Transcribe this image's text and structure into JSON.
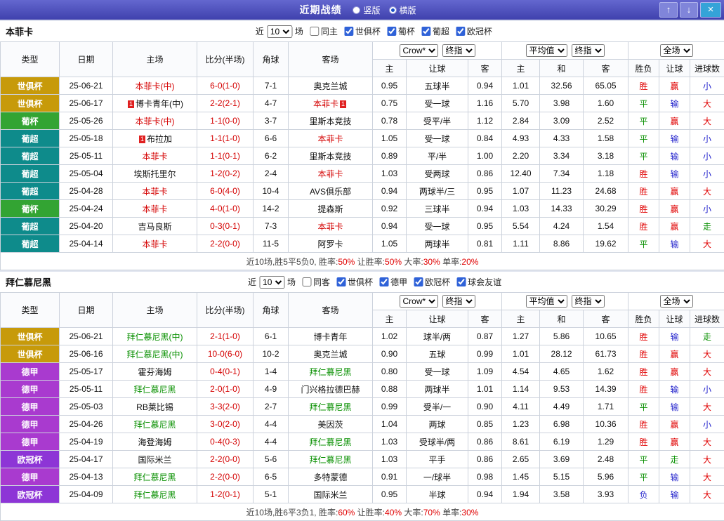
{
  "titlebar": {
    "title": "近期战绩",
    "radios": [
      {
        "label": "竖版",
        "selected": false
      },
      {
        "label": "横版",
        "selected": true
      }
    ],
    "buttons": {
      "up": "↑",
      "down": "↓",
      "close": "×"
    }
  },
  "filter_labels": {
    "near": "近",
    "count": "10",
    "games": "场"
  },
  "selects": {
    "odds_source": "Crow*",
    "odds_final": "终指",
    "avg_source": "平均值",
    "avg_final": "终指",
    "scope": "全场"
  },
  "table_headers": {
    "type": "类型",
    "date": "日期",
    "home": "主场",
    "score": "比分(半场)",
    "corner": "角球",
    "away": "客场",
    "odds_home": "主",
    "odds_handicap": "让球",
    "odds_away": "客",
    "avg_home": "主",
    "avg_draw": "和",
    "avg_away": "客",
    "result_wdl": "胜负",
    "result_handicap": "让球",
    "result_goals": "进球数"
  },
  "colors": {
    "competitions": {
      "世俱杯": "#C79A0A",
      "葡杯": "#33A433",
      "葡超": "#0E8B8B",
      "德甲": "#A93ACF",
      "欧冠杯": "#8D35D6"
    },
    "results": {
      "red": "#E00000",
      "blue": "#2323CC",
      "green": "#089000"
    },
    "score": "#D40000"
  },
  "sections": [
    {
      "team": "本菲卡",
      "team_color": "#D40000",
      "same_option": {
        "label": "同主",
        "checked": false
      },
      "competitions": [
        {
          "label": "世俱杯",
          "checked": true
        },
        {
          "label": "葡杯",
          "checked": true
        },
        {
          "label": "葡超",
          "checked": true
        },
        {
          "label": "欧冠杯",
          "checked": true
        }
      ],
      "rows": [
        {
          "comp": "世俱杯",
          "date": "25-06-21",
          "home": "本菲卡(中)",
          "home_is_team": true,
          "score": "6-0(1-0)",
          "corners": "7-1",
          "away": "奥克兰城",
          "away_is_team": false,
          "odds": [
            "0.95",
            "五球半",
            "0.94"
          ],
          "averages": [
            "1.01",
            "32.56",
            "65.05"
          ],
          "results": [
            {
              "text": "胜",
              "color": "red"
            },
            {
              "text": "赢",
              "color": "red"
            },
            {
              "text": "小",
              "color": "blue"
            }
          ]
        },
        {
          "comp": "世俱杯",
          "date": "25-06-17",
          "home": "博卡青年(中)",
          "home_is_team": false,
          "home_card": "1",
          "score": "2-2(2-1)",
          "corners": "4-7",
          "away": "本菲卡",
          "away_is_team": true,
          "away_card": "1",
          "odds": [
            "0.75",
            "受一球",
            "1.16"
          ],
          "averages": [
            "5.70",
            "3.98",
            "1.60"
          ],
          "results": [
            {
              "text": "平",
              "color": "green"
            },
            {
              "text": "输",
              "color": "blue"
            },
            {
              "text": "大",
              "color": "red"
            }
          ]
        },
        {
          "comp": "葡杯",
          "date": "25-05-26",
          "home": "本菲卡(中)",
          "home_is_team": true,
          "score": "1-1(0-0)",
          "corners": "3-7",
          "away": "里斯本竞技",
          "away_is_team": false,
          "odds": [
            "0.78",
            "受平/半",
            "1.12"
          ],
          "averages": [
            "2.84",
            "3.09",
            "2.52"
          ],
          "results": [
            {
              "text": "平",
              "color": "green"
            },
            {
              "text": "赢",
              "color": "red"
            },
            {
              "text": "大",
              "color": "red"
            }
          ]
        },
        {
          "comp": "葡超",
          "date": "25-05-18",
          "home": "布拉加",
          "home_is_team": false,
          "home_card": "1",
          "score": "1-1(1-0)",
          "corners": "6-6",
          "away": "本菲卡",
          "away_is_team": true,
          "odds": [
            "1.05",
            "受一球",
            "0.84"
          ],
          "averages": [
            "4.93",
            "4.33",
            "1.58"
          ],
          "results": [
            {
              "text": "平",
              "color": "green"
            },
            {
              "text": "输",
              "color": "blue"
            },
            {
              "text": "小",
              "color": "blue"
            }
          ]
        },
        {
          "comp": "葡超",
          "date": "25-05-11",
          "home": "本菲卡",
          "home_is_team": true,
          "score": "1-1(0-1)",
          "corners": "6-2",
          "away": "里斯本竞技",
          "away_is_team": false,
          "odds": [
            "0.89",
            "平/半",
            "1.00"
          ],
          "averages": [
            "2.20",
            "3.34",
            "3.18"
          ],
          "results": [
            {
              "text": "平",
              "color": "green"
            },
            {
              "text": "输",
              "color": "blue"
            },
            {
              "text": "小",
              "color": "blue"
            }
          ]
        },
        {
          "comp": "葡超",
          "date": "25-05-04",
          "home": "埃斯托里尔",
          "home_is_team": false,
          "score": "1-2(0-2)",
          "corners": "2-4",
          "away": "本菲卡",
          "away_is_team": true,
          "odds": [
            "1.03",
            "受两球",
            "0.86"
          ],
          "averages": [
            "12.40",
            "7.34",
            "1.18"
          ],
          "results": [
            {
              "text": "胜",
              "color": "red"
            },
            {
              "text": "输",
              "color": "blue"
            },
            {
              "text": "小",
              "color": "blue"
            }
          ]
        },
        {
          "comp": "葡超",
          "date": "25-04-28",
          "home": "本菲卡",
          "home_is_team": true,
          "score": "6-0(4-0)",
          "corners": "10-4",
          "away": "AVS俱乐部",
          "away_is_team": false,
          "odds": [
            "0.94",
            "两球半/三",
            "0.95"
          ],
          "averages": [
            "1.07",
            "11.23",
            "24.68"
          ],
          "results": [
            {
              "text": "胜",
              "color": "red"
            },
            {
              "text": "赢",
              "color": "red"
            },
            {
              "text": "大",
              "color": "red"
            }
          ]
        },
        {
          "comp": "葡杯",
          "date": "25-04-24",
          "home": "本菲卡",
          "home_is_team": true,
          "score": "4-0(1-0)",
          "corners": "14-2",
          "away": "提森斯",
          "away_is_team": false,
          "odds": [
            "0.92",
            "三球半",
            "0.94"
          ],
          "averages": [
            "1.03",
            "14.33",
            "30.29"
          ],
          "results": [
            {
              "text": "胜",
              "color": "red"
            },
            {
              "text": "赢",
              "color": "red"
            },
            {
              "text": "小",
              "color": "blue"
            }
          ]
        },
        {
          "comp": "葡超",
          "date": "25-04-20",
          "home": "吉马良斯",
          "home_is_team": false,
          "score": "0-3(0-1)",
          "corners": "7-3",
          "away": "本菲卡",
          "away_is_team": true,
          "odds": [
            "0.94",
            "受一球",
            "0.95"
          ],
          "averages": [
            "5.54",
            "4.24",
            "1.54"
          ],
          "results": [
            {
              "text": "胜",
              "color": "red"
            },
            {
              "text": "赢",
              "color": "red"
            },
            {
              "text": "走",
              "color": "green"
            }
          ]
        },
        {
          "comp": "葡超",
          "date": "25-04-14",
          "home": "本菲卡",
          "home_is_team": true,
          "score": "2-2(0-0)",
          "corners": "11-5",
          "away": "阿罗卡",
          "away_is_team": false,
          "odds": [
            "1.05",
            "两球半",
            "0.81"
          ],
          "averages": [
            "1.11",
            "8.86",
            "19.62"
          ],
          "results": [
            {
              "text": "平",
              "color": "green"
            },
            {
              "text": "输",
              "color": "blue"
            },
            {
              "text": "大",
              "color": "red"
            }
          ]
        }
      ],
      "summary": {
        "prefix": "近10场,胜5平5负0,",
        "stats": [
          {
            "label": "胜率:",
            "value": "50%"
          },
          {
            "label": "让胜率:",
            "value": "50%"
          },
          {
            "label": "大率:",
            "value": "30%"
          },
          {
            "label": "单率:",
            "value": "20%"
          }
        ]
      }
    },
    {
      "team": "拜仁慕尼黑",
      "team_color": "#089000",
      "same_option": {
        "label": "同客",
        "checked": false
      },
      "competitions": [
        {
          "label": "世俱杯",
          "checked": true
        },
        {
          "label": "德甲",
          "checked": true
        },
        {
          "label": "欧冠杯",
          "checked": true
        },
        {
          "label": "球会友谊",
          "checked": true
        }
      ],
      "rows": [
        {
          "comp": "世俱杯",
          "date": "25-06-21",
          "home": "拜仁慕尼黑(中)",
          "home_is_team": true,
          "score": "2-1(1-0)",
          "corners": "6-1",
          "away": "博卡青年",
          "away_is_team": false,
          "odds": [
            "1.02",
            "球半/两",
            "0.87"
          ],
          "averages": [
            "1.27",
            "5.86",
            "10.65"
          ],
          "results": [
            {
              "text": "胜",
              "color": "red"
            },
            {
              "text": "输",
              "color": "blue"
            },
            {
              "text": "走",
              "color": "green"
            }
          ]
        },
        {
          "comp": "世俱杯",
          "date": "25-06-16",
          "home": "拜仁慕尼黑(中)",
          "home_is_team": true,
          "score": "10-0(6-0)",
          "corners": "10-2",
          "away": "奥克兰城",
          "away_is_team": false,
          "odds": [
            "0.90",
            "五球",
            "0.99"
          ],
          "averages": [
            "1.01",
            "28.12",
            "61.73"
          ],
          "results": [
            {
              "text": "胜",
              "color": "red"
            },
            {
              "text": "赢",
              "color": "red"
            },
            {
              "text": "大",
              "color": "red"
            }
          ]
        },
        {
          "comp": "德甲",
          "date": "25-05-17",
          "home": "霍芬海姆",
          "home_is_team": false,
          "score": "0-4(0-1)",
          "corners": "1-4",
          "away": "拜仁慕尼黑",
          "away_is_team": true,
          "odds": [
            "0.80",
            "受一球",
            "1.09"
          ],
          "averages": [
            "4.54",
            "4.65",
            "1.62"
          ],
          "results": [
            {
              "text": "胜",
              "color": "red"
            },
            {
              "text": "赢",
              "color": "red"
            },
            {
              "text": "大",
              "color": "red"
            }
          ]
        },
        {
          "comp": "德甲",
          "date": "25-05-11",
          "home": "拜仁慕尼黑",
          "home_is_team": true,
          "score": "2-0(1-0)",
          "corners": "4-9",
          "away": "门兴格拉德巴赫",
          "away_is_team": false,
          "odds": [
            "0.88",
            "两球半",
            "1.01"
          ],
          "averages": [
            "1.14",
            "9.53",
            "14.39"
          ],
          "results": [
            {
              "text": "胜",
              "color": "red"
            },
            {
              "text": "输",
              "color": "blue"
            },
            {
              "text": "小",
              "color": "blue"
            }
          ]
        },
        {
          "comp": "德甲",
          "date": "25-05-03",
          "home": "RB莱比锡",
          "home_is_team": false,
          "score": "3-3(2-0)",
          "corners": "2-7",
          "away": "拜仁慕尼黑",
          "away_is_team": true,
          "odds": [
            "0.99",
            "受半/一",
            "0.90"
          ],
          "averages": [
            "4.11",
            "4.49",
            "1.71"
          ],
          "results": [
            {
              "text": "平",
              "color": "green"
            },
            {
              "text": "输",
              "color": "blue"
            },
            {
              "text": "大",
              "color": "red"
            }
          ]
        },
        {
          "comp": "德甲",
          "date": "25-04-26",
          "home": "拜仁慕尼黑",
          "home_is_team": true,
          "score": "3-0(2-0)",
          "corners": "4-4",
          "away": "美因茨",
          "away_is_team": false,
          "odds": [
            "1.04",
            "两球",
            "0.85"
          ],
          "averages": [
            "1.23",
            "6.98",
            "10.36"
          ],
          "results": [
            {
              "text": "胜",
              "color": "red"
            },
            {
              "text": "赢",
              "color": "red"
            },
            {
              "text": "小",
              "color": "blue"
            }
          ]
        },
        {
          "comp": "德甲",
          "date": "25-04-19",
          "home": "海登海姆",
          "home_is_team": false,
          "score": "0-4(0-3)",
          "corners": "4-4",
          "away": "拜仁慕尼黑",
          "away_is_team": true,
          "odds": [
            "1.03",
            "受球半/两",
            "0.86"
          ],
          "averages": [
            "8.61",
            "6.19",
            "1.29"
          ],
          "results": [
            {
              "text": "胜",
              "color": "red"
            },
            {
              "text": "赢",
              "color": "red"
            },
            {
              "text": "大",
              "color": "red"
            }
          ]
        },
        {
          "comp": "欧冠杯",
          "date": "25-04-17",
          "home": "国际米兰",
          "home_is_team": false,
          "score": "2-2(0-0)",
          "corners": "5-6",
          "away": "拜仁慕尼黑",
          "away_is_team": true,
          "odds": [
            "1.03",
            "平手",
            "0.86"
          ],
          "averages": [
            "2.65",
            "3.69",
            "2.48"
          ],
          "results": [
            {
              "text": "平",
              "color": "green"
            },
            {
              "text": "走",
              "color": "green"
            },
            {
              "text": "大",
              "color": "red"
            }
          ]
        },
        {
          "comp": "德甲",
          "date": "25-04-13",
          "home": "拜仁慕尼黑",
          "home_is_team": true,
          "score": "2-2(0-0)",
          "corners": "6-5",
          "away": "多特蒙德",
          "away_is_team": false,
          "odds": [
            "0.91",
            "一/球半",
            "0.98"
          ],
          "averages": [
            "1.45",
            "5.15",
            "5.96"
          ],
          "results": [
            {
              "text": "平",
              "color": "green"
            },
            {
              "text": "输",
              "color": "blue"
            },
            {
              "text": "大",
              "color": "red"
            }
          ]
        },
        {
          "comp": "欧冠杯",
          "date": "25-04-09",
          "home": "拜仁慕尼黑",
          "home_is_team": true,
          "score": "1-2(0-1)",
          "corners": "5-1",
          "away": "国际米兰",
          "away_is_team": false,
          "odds": [
            "0.95",
            "半球",
            "0.94"
          ],
          "averages": [
            "1.94",
            "3.58",
            "3.93"
          ],
          "results": [
            {
              "text": "负",
              "color": "blue"
            },
            {
              "text": "输",
              "color": "blue"
            },
            {
              "text": "大",
              "color": "red"
            }
          ]
        }
      ],
      "summary": {
        "prefix": "近10场,胜6平3负1,",
        "stats": [
          {
            "label": "胜率:",
            "value": "60%"
          },
          {
            "label": "让胜率:",
            "value": "40%"
          },
          {
            "label": "大率:",
            "value": "70%"
          },
          {
            "label": "单率:",
            "value": "30%"
          }
        ]
      }
    }
  ]
}
